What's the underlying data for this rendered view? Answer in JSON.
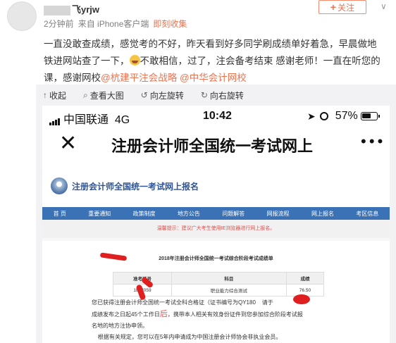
{
  "post": {
    "username_visible": "飞yrjw",
    "time": "2分钟前",
    "source": "来自 iPhone客户端",
    "collect_link": "即刻收集",
    "follow_label": "关注",
    "text_line1": "一直没敢查成绩，感觉考的不好，昨天看到好多同学刷成绩单好着急，早晨做地",
    "text_line2_a": "铁进网站查了一下，",
    "text_line2_b": "不敢相信，过了，注会备考结束 感谢老师！一直在听您的",
    "text_line3_a": "课，感谢网校",
    "mention1": "@杭建平注会战略",
    "mention2": "@中华会计网校"
  },
  "toolbar": {
    "collapse": "收起",
    "view_large": "查看大图",
    "rotate_left": "向左旋转",
    "rotate_right": "向右旋转"
  },
  "phone": {
    "carrier": "中国联通",
    "network": "4G",
    "time": "10:42",
    "battery_pct": "57%",
    "page_title": "注册会计师全国统一考试网上"
  },
  "site": {
    "title": "注册会计师全国统一考试网上报名",
    "nav": [
      "首  页",
      "重要通知",
      "政策制度",
      "地方公告",
      "问题解答",
      "网报流程",
      "网上报名",
      "考区信息"
    ],
    "notice": "温馨提示：建议广大考生使用IE浏览器进行网上报名。",
    "result_title": "2018年注册会计师全国统一考试综合阶段考试成绩单",
    "table_headers": [
      "准考证号",
      "科目",
      "成绩"
    ],
    "table_row": [
      "1807059",
      "职业能力综合测试",
      "76.50"
    ],
    "body_line1": "您已获得注册会计师全国统一考试全科合格证（证书编号为QY180",
    "body_line1_end": "请于",
    "body_line2_a": "成绩发布之日起45个工作日",
    "body_line2_red": "后",
    "body_line2_b": "，携带本人相关有效身份证件到您参加综合阶段考试报",
    "body_line3": "名地的地方注协申领。",
    "body_line4": "根据有关规定，您可以在5年内申请成为中国注册会计师协会非执业会员。"
  }
}
